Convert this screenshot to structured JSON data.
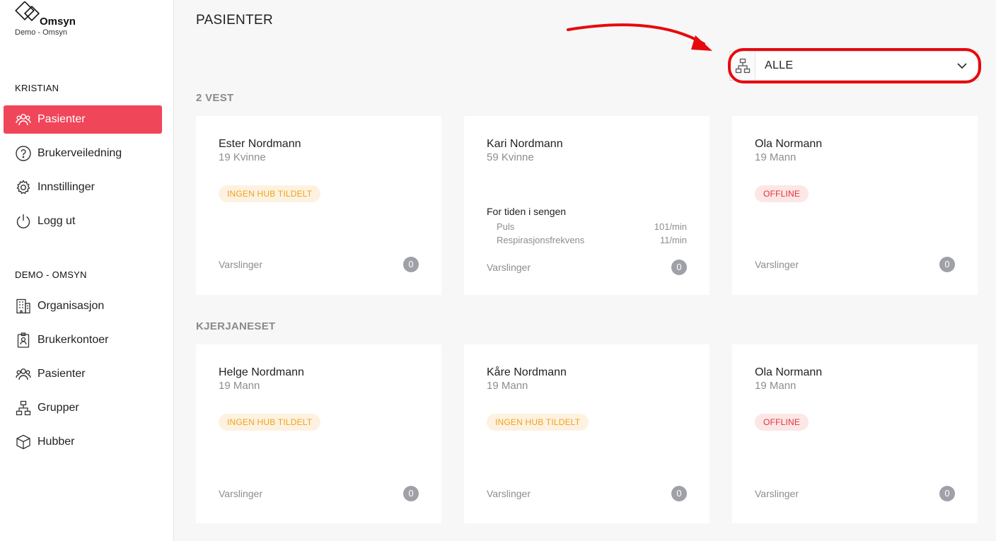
{
  "app": {
    "brand": "Omsyn",
    "org_subtitle": "Demo - Omsyn"
  },
  "sidebar": {
    "user_section": "KRISTIAN",
    "user_items": [
      {
        "label": "Pasienter",
        "icon": "users-icon",
        "active": true
      },
      {
        "label": "Brukerveiledning",
        "icon": "help-icon"
      },
      {
        "label": "Innstillinger",
        "icon": "gear-icon"
      },
      {
        "label": "Logg ut",
        "icon": "power-icon"
      }
    ],
    "org_section": "DEMO - OMSYN",
    "org_items": [
      {
        "label": "Organisasjon",
        "icon": "building-icon"
      },
      {
        "label": "Brukerkontoer",
        "icon": "badge-icon"
      },
      {
        "label": "Pasienter",
        "icon": "users-icon"
      },
      {
        "label": "Grupper",
        "icon": "hierarchy-icon"
      },
      {
        "label": "Hubber",
        "icon": "cube-icon"
      }
    ]
  },
  "main": {
    "title": "PASIENTER",
    "group_filter": {
      "value": "ALLE",
      "icon": "hierarchy-icon"
    },
    "annotation": {
      "color": "#e8090c"
    },
    "groups": [
      {
        "name": "2 VEST",
        "patients": [
          {
            "name": "Ester Nordmann",
            "meta": "19 Kvinne",
            "badge": "INGEN HUB TILDELT",
            "badge_type": "warn",
            "alerts_label": "Varslinger",
            "alerts": "0"
          },
          {
            "name": "Kari Nordmann",
            "meta": "59 Kvinne",
            "status": "For tiden i sengen",
            "vitals": [
              {
                "label": "Puls",
                "value": "101/min"
              },
              {
                "label": "Respirasjonsfrekvens",
                "value": "11/min"
              }
            ],
            "alerts_label": "Varslinger",
            "alerts": "0"
          },
          {
            "name": "Ola Normann",
            "meta": "19 Mann",
            "badge": "OFFLINE",
            "badge_type": "off",
            "alerts_label": "Varslinger",
            "alerts": "0"
          }
        ]
      },
      {
        "name": "KJERJANESET",
        "patients": [
          {
            "name": "Helge Nordmann",
            "meta": "19 Mann",
            "badge": "INGEN HUB TILDELT",
            "badge_type": "warn",
            "alerts_label": "Varslinger",
            "alerts": "0"
          },
          {
            "name": "Kåre Nordmann",
            "meta": "19 Mann",
            "badge": "INGEN HUB TILDELT",
            "badge_type": "warn",
            "alerts_label": "Varslinger",
            "alerts": "0"
          },
          {
            "name": "Ola Normann",
            "meta": "19 Mann",
            "badge": "OFFLINE",
            "badge_type": "off",
            "alerts_label": "Varslinger",
            "alerts": "0"
          }
        ]
      }
    ]
  },
  "colors": {
    "accent": "#f0465a",
    "warn_text": "#f0a21d",
    "offline_text": "#e0323c",
    "muted": "#8d8d8d"
  }
}
